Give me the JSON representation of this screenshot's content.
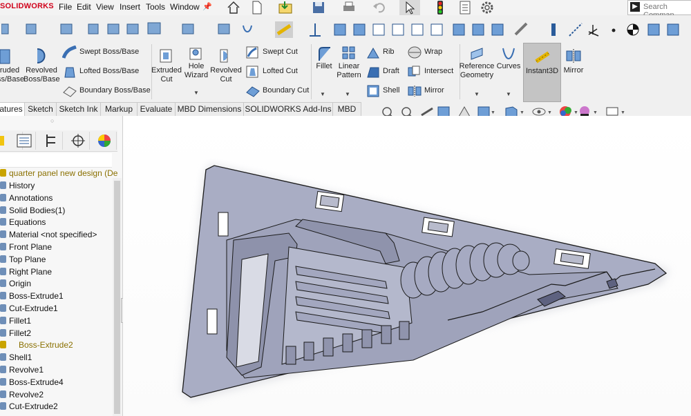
{
  "app": {
    "logo_text": "SOLIDWORKS"
  },
  "menu": {
    "items": [
      "File",
      "Edit",
      "View",
      "Insert",
      "Tools",
      "Window"
    ]
  },
  "search": {
    "placeholder": "Search Comman"
  },
  "commands": {
    "extruded_boss": "ruded\nss/Base",
    "revolved_boss": "Revolved\nBoss/Base",
    "swept_boss": "Swept Boss/Base",
    "lofted_boss": "Lofted Boss/Base",
    "boundary_boss": "Boundary Boss/Base",
    "extruded_cut": "Extruded\nCut",
    "hole_wizard": "Hole\nWizard",
    "revolved_cut": "Revolved\nCut",
    "swept_cut": "Swept Cut",
    "lofted_cut": "Lofted Cut",
    "boundary_cut": "Boundary Cut",
    "fillet": "Fillet",
    "linear_pattern": "Linear\nPattern",
    "rib": "Rib",
    "draft": "Draft",
    "shell": "Shell",
    "wrap": "Wrap",
    "intersect": "Intersect",
    "mirror_small": "Mirror",
    "reference_geometry": "Reference\nGeometry",
    "curves": "Curves",
    "instant3d": "Instant3D",
    "mirror": "Mirror"
  },
  "tabs": [
    {
      "label": "atures",
      "active": true
    },
    {
      "label": "Sketch"
    },
    {
      "label": "Sketch Ink"
    },
    {
      "label": "Markup"
    },
    {
      "label": "Evaluate"
    },
    {
      "label": "MBD Dimensions"
    },
    {
      "label": "SOLIDWORKS Add-Ins"
    },
    {
      "label": "MBD"
    }
  ],
  "tree": {
    "root": "quarter panel new design  (De",
    "items": [
      {
        "label": "History"
      },
      {
        "label": "Annotations"
      },
      {
        "label": "Solid Bodies(1)"
      },
      {
        "label": "Equations"
      },
      {
        "label": "Material <not specified>"
      },
      {
        "label": "Front Plane"
      },
      {
        "label": "Top Plane"
      },
      {
        "label": "Right Plane"
      },
      {
        "label": "Origin"
      },
      {
        "label": "Boss-Extrude1"
      },
      {
        "label": "Cut-Extrude1"
      },
      {
        "label": "Fillet1"
      },
      {
        "label": "Fillet2"
      },
      {
        "label": "Boss-Extrude2",
        "warning": true
      },
      {
        "label": "Shell1"
      },
      {
        "label": "Revolve1"
      },
      {
        "label": "Boss-Extrude4"
      },
      {
        "label": "Revolve2"
      },
      {
        "label": "Cut-Extrude2"
      }
    ]
  },
  "colors": {
    "part_fill": "#a9adc4",
    "part_shadow": "#7d82a0",
    "part_edge": "#1a1a1a",
    "warning": "#c9a400",
    "logo": "#d0021b"
  }
}
